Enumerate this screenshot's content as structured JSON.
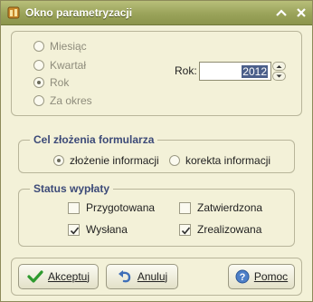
{
  "window": {
    "title": "Okno parametryzacji"
  },
  "period": {
    "options": [
      "Miesiąc",
      "Kwartał",
      "Rok",
      "Za okres"
    ],
    "selected": "Rok",
    "year_label": "Rok:",
    "year_value": "2012"
  },
  "purpose": {
    "legend": "Cel złożenia formularza",
    "options": [
      "złożenie informacji",
      "korekta informacji"
    ],
    "selected": "złożenie informacji"
  },
  "status": {
    "legend": "Status wypłaty",
    "items": [
      {
        "label": "Przygotowana",
        "checked": false
      },
      {
        "label": "Zatwierdzona",
        "checked": false
      },
      {
        "label": "Wysłana",
        "checked": true
      },
      {
        "label": "Zrealizowana",
        "checked": true
      }
    ]
  },
  "buttons": {
    "accept": "Akceptuj",
    "cancel": "Anuluj",
    "help": "Pomoc"
  },
  "icons": {
    "app": "app-icon",
    "minimize": "chevron-up-icon",
    "close": "close-icon",
    "accept": "checkmark-icon",
    "cancel": "undo-icon",
    "help": "help-icon"
  }
}
